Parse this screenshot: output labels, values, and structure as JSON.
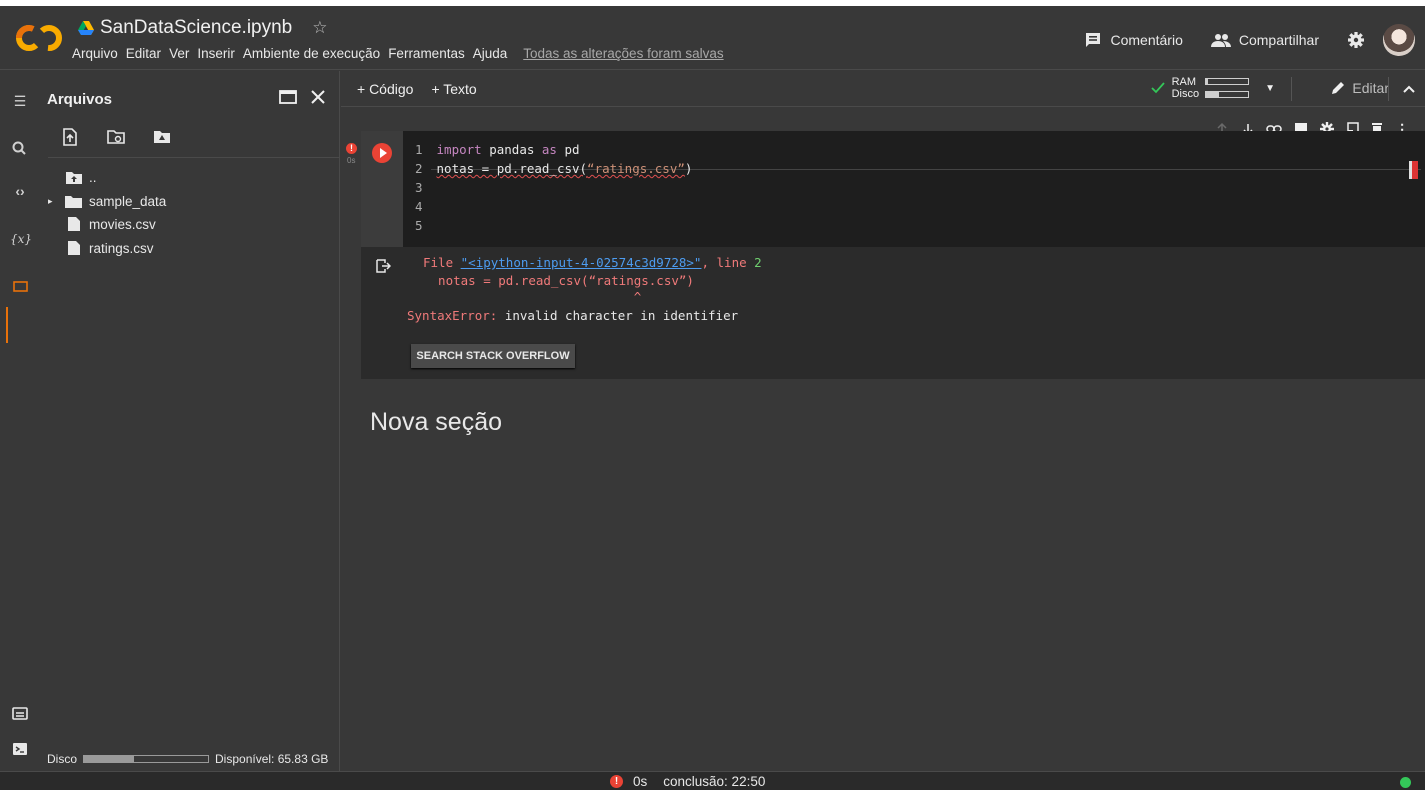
{
  "app": {
    "notebook_title": "SanDataScience.ipynb",
    "menu": [
      "Arquivo",
      "Editar",
      "Ver",
      "Inserir",
      "Ambiente de execução",
      "Ferramentas",
      "Ajuda"
    ],
    "save_status": "Todas as alterações foram salvas",
    "comment_label": "Comentário",
    "share_label": "Compartilhar"
  },
  "files_panel": {
    "title": "Arquivos",
    "items": [
      {
        "name": "..",
        "type": "parent"
      },
      {
        "name": "sample_data",
        "type": "folder"
      },
      {
        "name": "movies.csv",
        "type": "file"
      },
      {
        "name": "ratings.csv",
        "type": "file"
      }
    ],
    "disk_label": "Disco",
    "disk_usage_fraction": 0.4,
    "disk_available": "Disponível: 65.83 GB"
  },
  "toolbar": {
    "add_code": "+ Código",
    "add_text": "+ Texto",
    "ram_label": "RAM",
    "disk_label": "Disco",
    "ram_usage_fraction": 0.05,
    "disk_usage_fraction": 0.3,
    "edit_label": "Editar"
  },
  "cell": {
    "exec_time": "0s",
    "line_numbers": [
      "1",
      "2",
      "3",
      "4",
      "5"
    ],
    "line1": {
      "kw1": "import",
      "mid": " pandas ",
      "kw2": "as",
      "end": " pd"
    },
    "line2": {
      "pre": "notas = pd.read_csv(",
      "str": "“ratings.csv”",
      "post": ")"
    }
  },
  "output": {
    "file_prefix": "File ",
    "file_link": "\"<ipython-input-4-02574c3d9728>\"",
    "line_text": ", line ",
    "line_no": "2",
    "code_echo": "  notas = pd.read_csv(“ratings.csv”)",
    "caret": "                            ^",
    "error_type": "SyntaxError:",
    "error_msg": " invalid character in identifier",
    "so_button": "SEARCH STACK OVERFLOW"
  },
  "section": {
    "title": "Nova seção"
  },
  "statusbar": {
    "time": "0s",
    "completion": "conclusão: 22:50"
  },
  "colors": {
    "accent_orange": "#e8710a",
    "error_red": "#ea4335",
    "ok_green": "#34c759"
  }
}
